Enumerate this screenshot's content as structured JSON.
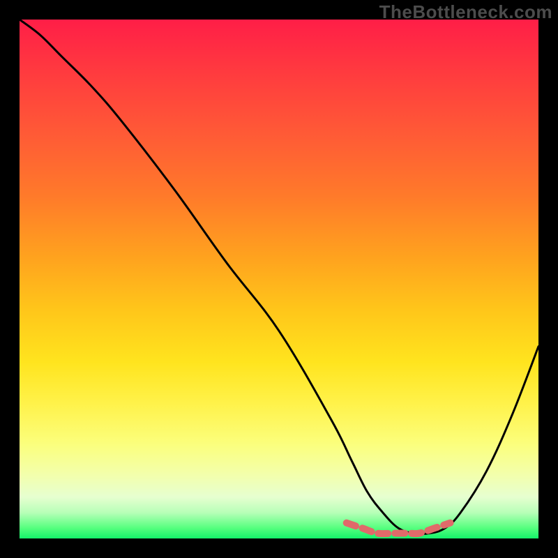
{
  "watermark": "TheBottleneck.com",
  "chart_data": {
    "type": "line",
    "title": "",
    "xlabel": "",
    "ylabel": "",
    "xlim": [
      0,
      100
    ],
    "ylim": [
      0,
      100
    ],
    "grid": false,
    "legend": false,
    "gradient_colors": {
      "top": "#ff1e47",
      "mid1": "#ff7a2a",
      "mid2": "#ffe41e",
      "bottom": "#14f36a"
    },
    "series": [
      {
        "name": "bottleneck-curve",
        "color": "#000000",
        "x": [
          0,
          4,
          8,
          14,
          20,
          30,
          40,
          50,
          60,
          64,
          67,
          70,
          73,
          76,
          79,
          82,
          85,
          90,
          95,
          100
        ],
        "y": [
          100,
          97,
          93,
          87,
          80,
          67,
          53,
          40,
          23,
          15,
          9,
          5,
          2,
          1,
          1,
          2,
          5,
          13,
          24,
          37
        ]
      },
      {
        "name": "optimal-highlight",
        "color": "#e06a6a",
        "x": [
          63,
          66,
          69,
          72,
          75,
          77,
          80,
          83
        ],
        "y": [
          3,
          2,
          1,
          1,
          1,
          1,
          2,
          3
        ]
      }
    ],
    "annotations": []
  }
}
